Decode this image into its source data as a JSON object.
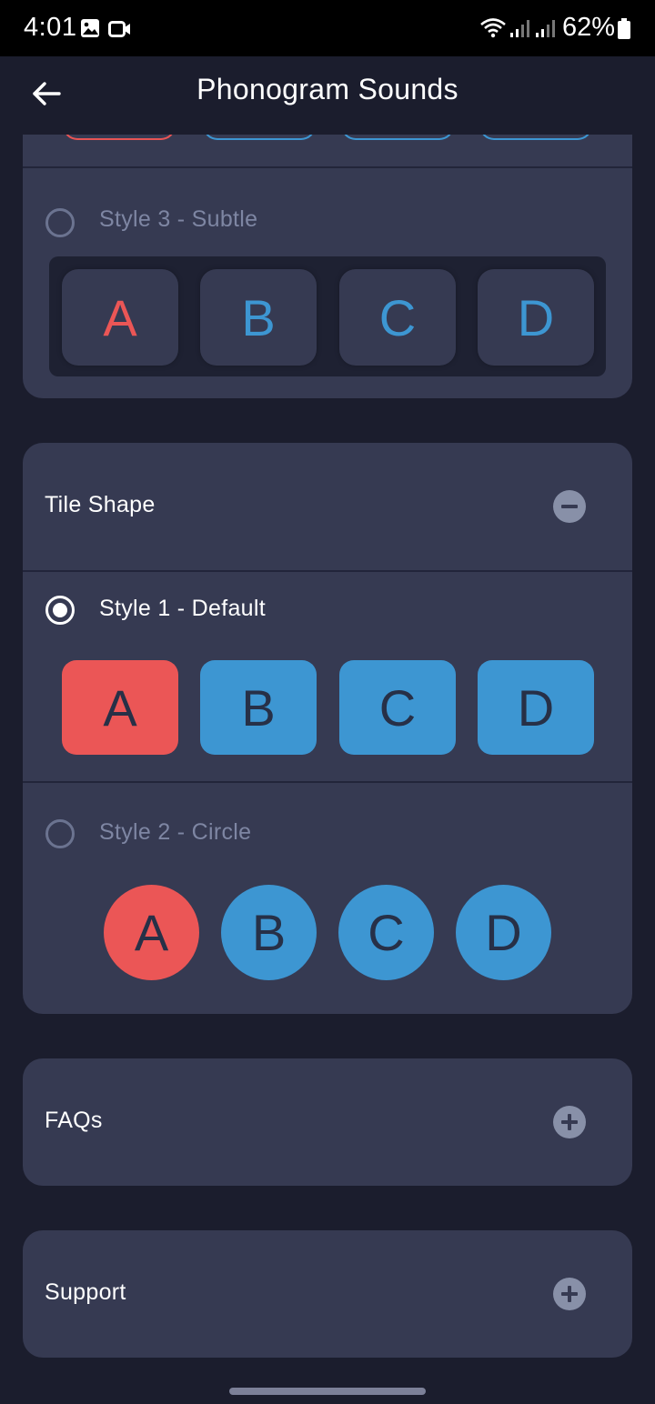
{
  "status_bar": {
    "time": "4:01",
    "battery": "62%",
    "icons": [
      "gallery-icon",
      "video-icon",
      "wifi-icon",
      "signal-icon",
      "signal-icon",
      "battery-icon"
    ]
  },
  "header": {
    "title": "Phonogram Sounds",
    "back_icon": "arrow-left-icon"
  },
  "colors": {
    "background": "#1b1d2d",
    "card": "#363a52",
    "red": "#eb5656",
    "blue": "#3d96d2",
    "letter_dark": "#273047"
  },
  "tile_color": {
    "style3": {
      "label": "Style 3 - Subtle",
      "selected": false,
      "tiles": [
        "A",
        "B",
        "C",
        "D"
      ]
    }
  },
  "tile_shape": {
    "title": "Tile Shape",
    "toggle_icon": "minus-circle-icon",
    "style1": {
      "label": "Style 1 - Default",
      "selected": true,
      "tiles": [
        "A",
        "B",
        "C",
        "D"
      ]
    },
    "style2": {
      "label": "Style 2 - Circle",
      "selected": false,
      "tiles": [
        "A",
        "B",
        "C",
        "D"
      ]
    }
  },
  "faqs": {
    "title": "FAQs",
    "toggle_icon": "plus-circle-icon"
  },
  "support": {
    "title": "Support",
    "toggle_icon": "plus-circle-icon"
  }
}
